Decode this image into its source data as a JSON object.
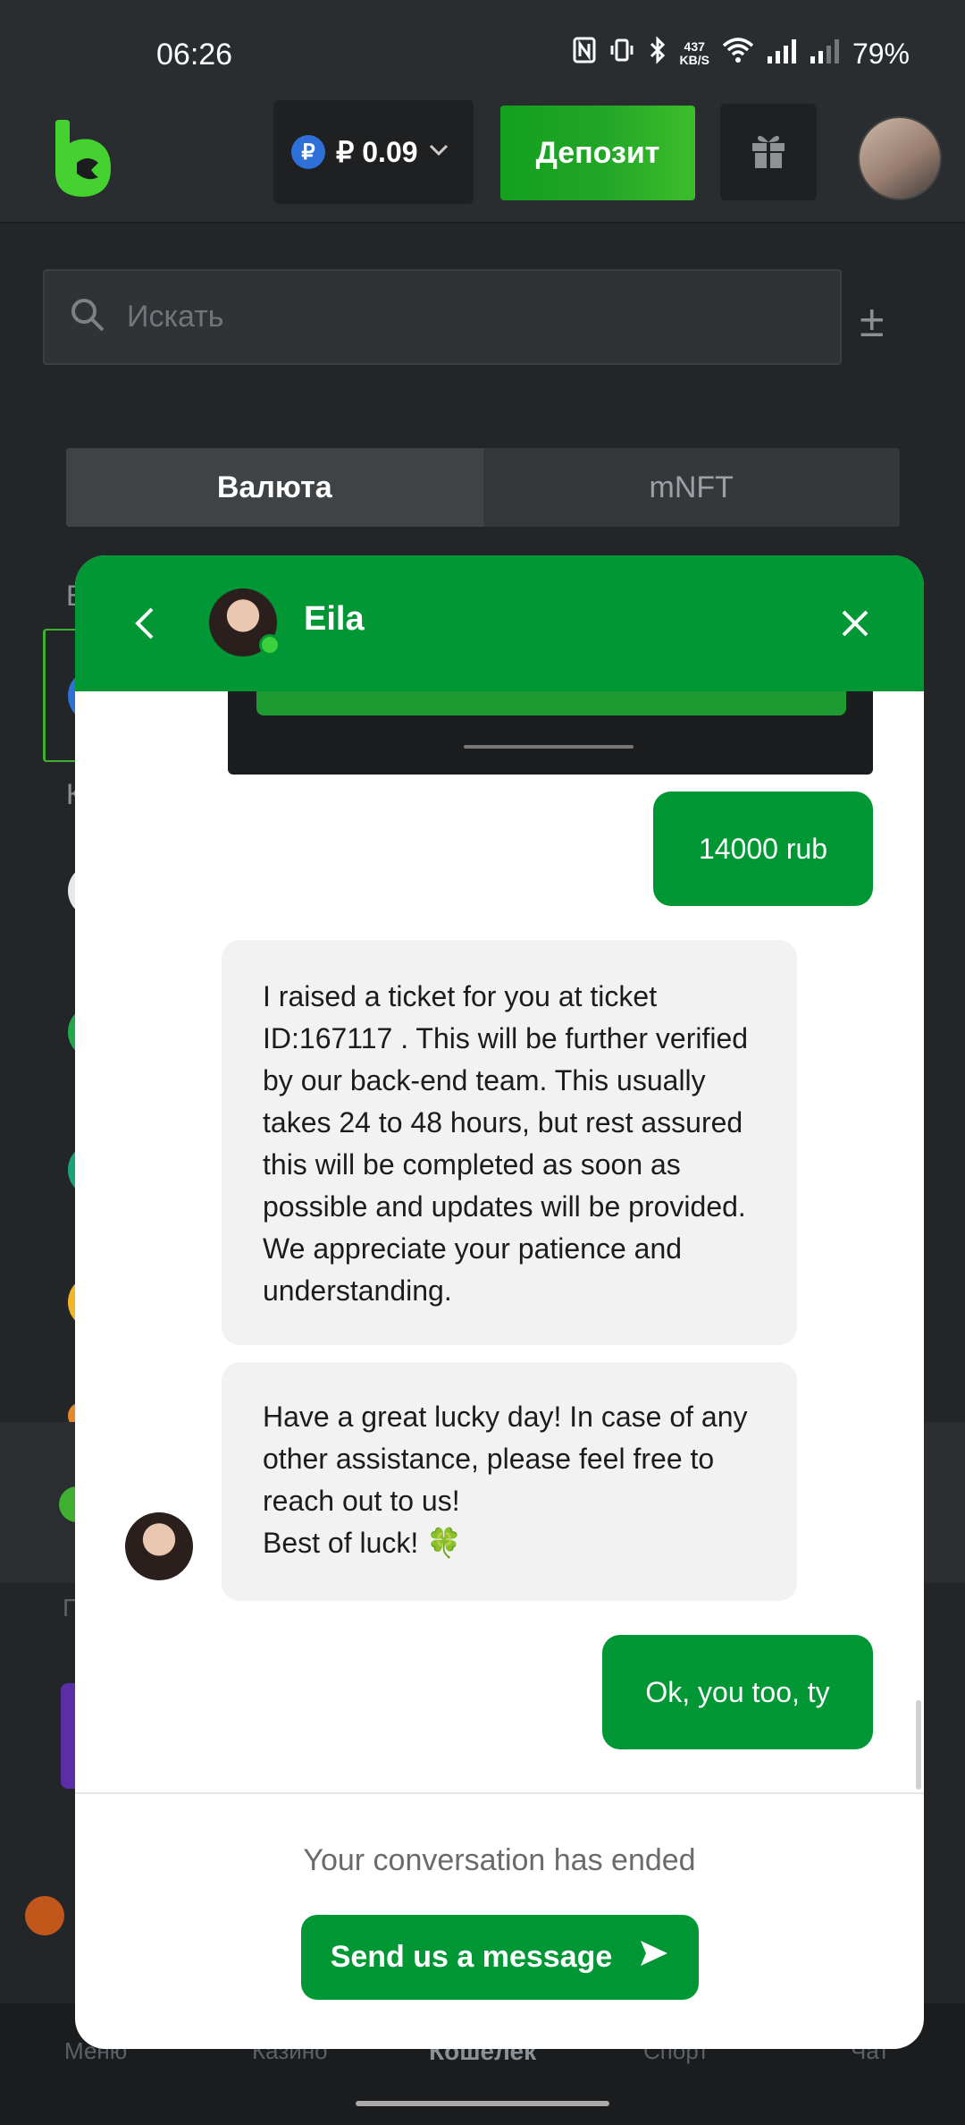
{
  "status_bar": {
    "time": "06:26",
    "speed_value": "437",
    "speed_unit": "KB/S",
    "battery": "79%"
  },
  "header": {
    "currency_symbol": "₽",
    "balance": "₽ 0.09",
    "deposit_label": "Депозит"
  },
  "search": {
    "placeholder": "Искать"
  },
  "tabs": [
    {
      "label": "Валюта"
    },
    {
      "label": "mNFT"
    }
  ],
  "background_fragments": {
    "letter_b": "В",
    "letter_k": "К",
    "letter_p": "П"
  },
  "bottom_nav": [
    {
      "label": "Меню"
    },
    {
      "label": "Казино"
    },
    {
      "label": "Кошелек"
    },
    {
      "label": "Спорт"
    },
    {
      "label": "Чат"
    }
  ],
  "chat": {
    "agent_name": "Eila",
    "messages": [
      {
        "from": "user",
        "text": "14000 rub"
      },
      {
        "from": "agent",
        "text": "I raised a ticket for you at ticket ID:167117 . This will be further verified by our back-end team. This usually takes 24 to 48 hours, but rest assured this will be completed as soon as possible and updates will be provided. We appreciate your patience and understanding."
      },
      {
        "from": "agent",
        "text": "Have a great lucky day! In case of any other assistance, please feel free to reach out to us!\nBest of luck! 🍀"
      },
      {
        "from": "user",
        "text": "Ok, you too, ty"
      }
    ],
    "ended_text": "Your conversation has ended",
    "send_label": "Send us a message"
  },
  "colors": {
    "brand_green": "#019735",
    "deposit_green": "#21a527",
    "background": "#232628"
  }
}
